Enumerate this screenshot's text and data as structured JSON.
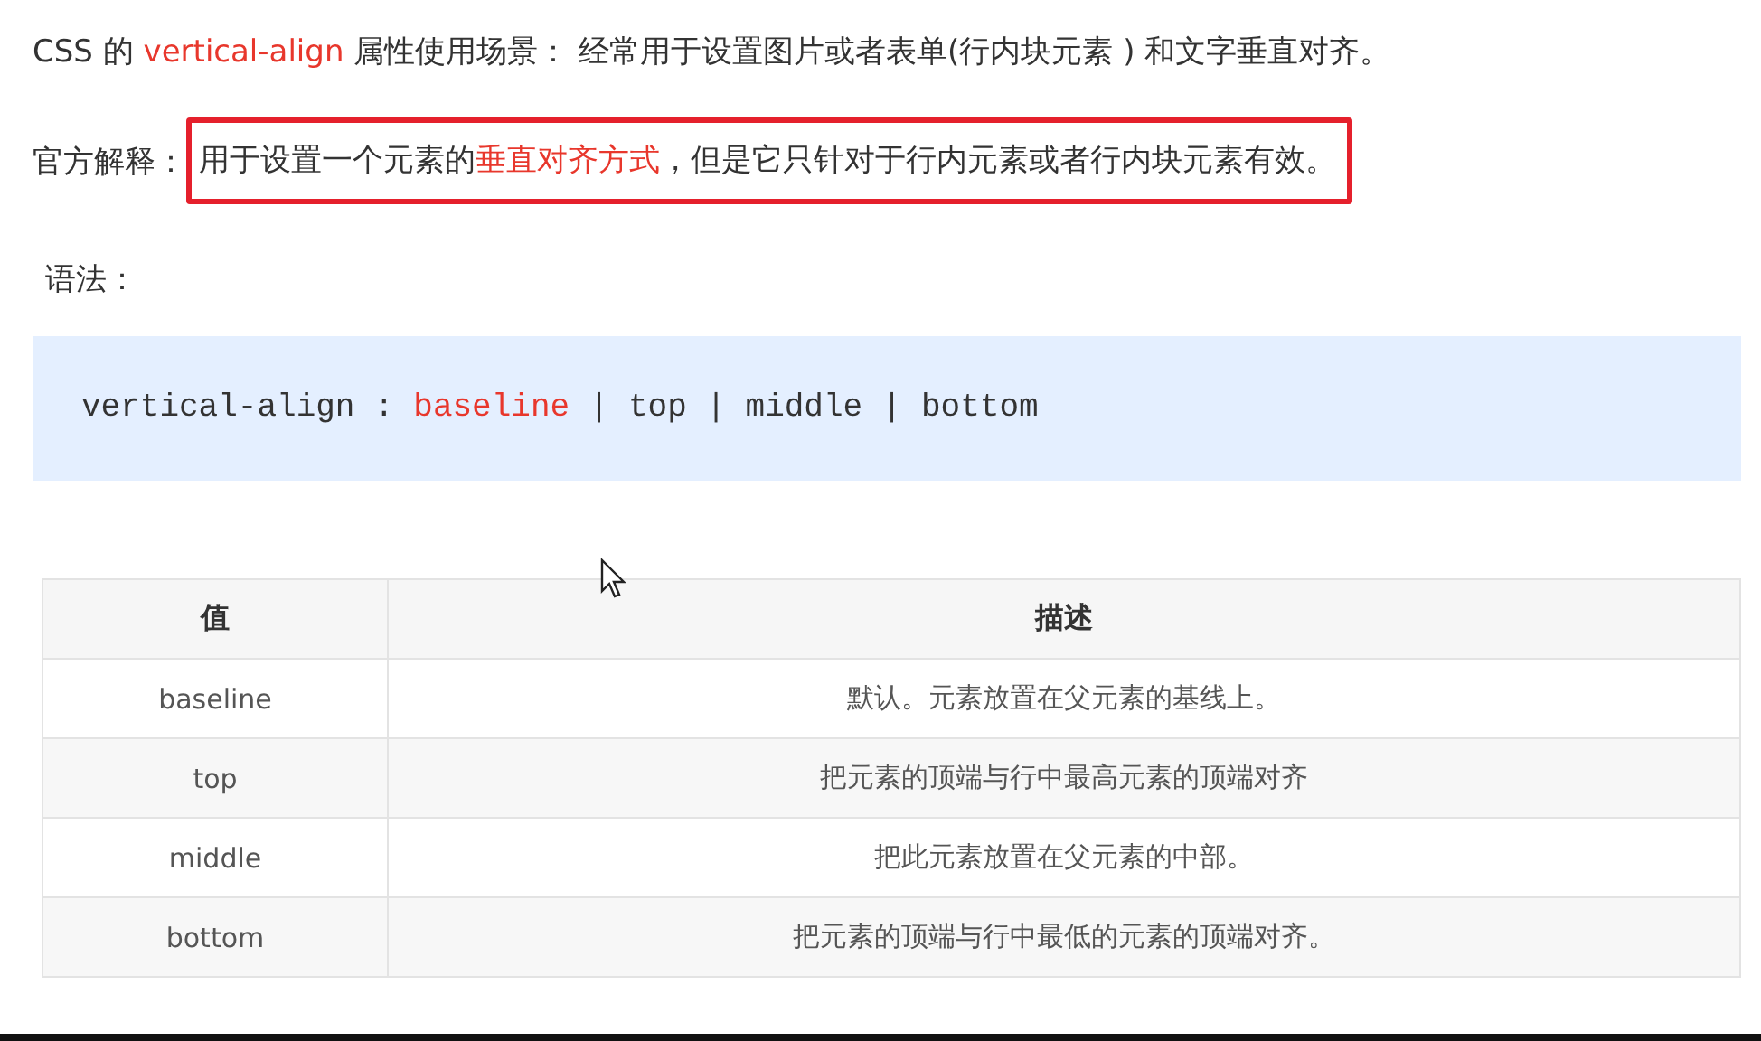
{
  "intro": [
    {
      "text": "CSS 的 ",
      "highlighted": false
    },
    {
      "text": "vertical-align",
      "highlighted": true
    },
    {
      "text": " 属性使用场景：  经常用于设置图片或者表单(行内块元素 ) 和文字垂直对齐。",
      "highlighted": false
    }
  ],
  "definition": {
    "label": "官方解释：",
    "boxed": true,
    "segments": [
      {
        "text": "用于设置一个元素的",
        "highlighted": false
      },
      {
        "text": "垂直对齐方式",
        "highlighted": true
      },
      {
        "text": "，但是它只针对于行内元素或者行内块元素有效。",
        "highlighted": false
      }
    ]
  },
  "syntax_heading": "语法：",
  "code": [
    {
      "text": "vertical-align : ",
      "highlighted": false
    },
    {
      "text": "baseline",
      "highlighted": true
    },
    {
      "text": " | top | middle | bottom",
      "highlighted": false
    }
  ],
  "table": {
    "columns": [
      "值",
      "描述"
    ],
    "rows": [
      [
        "baseline",
        "默认。元素放置在父元素的基线上。"
      ],
      [
        "top",
        "把元素的顶端与行中最高元素的顶端对齐"
      ],
      [
        "middle",
        "把此元素放置在父元素的中部。"
      ],
      [
        "bottom",
        "把元素的顶端与行中最低的元素的顶端对齐。"
      ]
    ]
  }
}
